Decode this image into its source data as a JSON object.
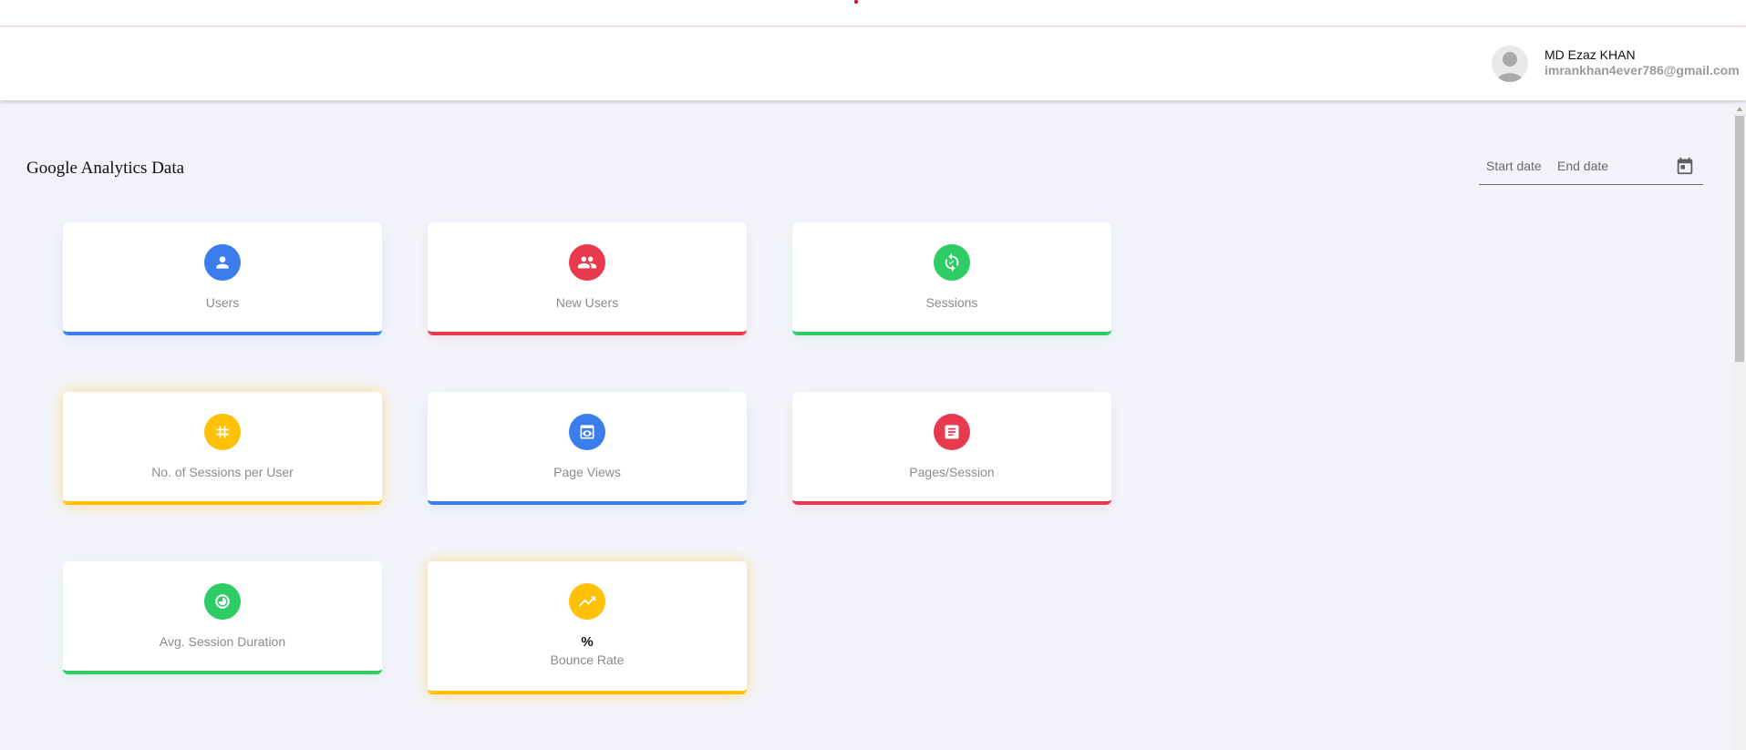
{
  "header": {
    "user_name": "MD Ezaz KHAN",
    "user_email": "imrankhan4ever786@gmail.com"
  },
  "page": {
    "title": "Google Analytics Data"
  },
  "date_range": {
    "start_placeholder": "Start date",
    "end_placeholder": "End date",
    "calendar_icon": "calendar-icon"
  },
  "cards": [
    {
      "label": "Users",
      "icon": "person-icon",
      "color": "#3b7ded"
    },
    {
      "label": "New Users",
      "icon": "group-icon",
      "color": "#e83a4f"
    },
    {
      "label": "Sessions",
      "icon": "sync-icon",
      "color": "#2ecc64"
    },
    {
      "label": "No. of Sessions per User",
      "icon": "hash-icon",
      "color": "#ffc107"
    },
    {
      "label": "Page Views",
      "icon": "preview-icon",
      "color": "#3b7ded"
    },
    {
      "label": "Pages/Session",
      "icon": "document-icon",
      "color": "#e83a4f"
    },
    {
      "label": "Avg. Session Duration",
      "icon": "timer-icon",
      "color": "#2ecc64"
    },
    {
      "label": "Bounce Rate",
      "value": "%",
      "icon": "trending-up-icon",
      "color": "#ffc107"
    }
  ]
}
